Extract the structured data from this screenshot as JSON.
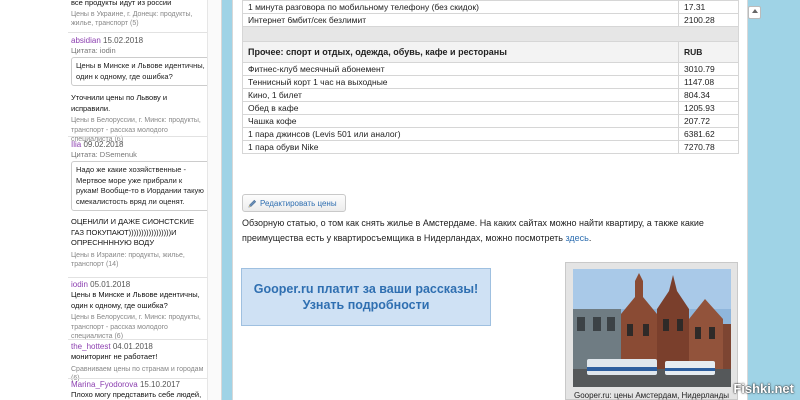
{
  "sidebar": {
    "top_text": "все продукты идут из россии",
    "top_meta": "Цены в Украине, г. Донецк: продукты, жилье, транспорт",
    "top_meta_count": "(5)",
    "comments": [
      {
        "author": "absidian",
        "date": "15.02.2018",
        "quote_label": "Цитата: iodin",
        "quote": "Цены в Минске и Львове идентичны, один к одному, где ошибка?",
        "text": "Уточнили цены по Львову и исправили.",
        "meta": "Цены в Белоруссии, г. Минск: продукты, транспорт - рассказ молодого специалиста",
        "meta_count": "(6)"
      },
      {
        "author": "Ilia",
        "date": "09.02.2018",
        "quote_label": "Цитата: DSemenuk",
        "quote": "Надо же какие хозяйственные - Мертвое море уже прибрали к рукам! Вообще-то в Иордании такую смекалистость вряд ли оценят.",
        "text": "ОЦЕНИЛИ И ДАЖЕ СИОНСТСКИЕ ГАЗ ПОКУПАЮТ)))))))))))))))))И ОПРЕСННННУЮ ВОДУ",
        "meta": "Цены в Израиле: продукты, жилье, транспорт",
        "meta_count": "(14)"
      },
      {
        "author": "iodin",
        "date": "05.01.2018",
        "text": "Цены в Минске и Львове идентичны, один к одному, где ошибка?",
        "meta": "Цены в Белоруссии, г. Минск: продукты, транспорт - рассказ молодого специалиста",
        "meta_count": "(6)"
      },
      {
        "author": "the_hottest",
        "date": "04.01.2018",
        "text": "мониторинг не работает!",
        "meta": "Сравниваем цены по странам и городам",
        "meta_count": "(6)"
      },
      {
        "author": "Marina_Fyodorova",
        "date": "15.10.2017",
        "text": "Плохо могу представить себе людей,"
      }
    ]
  },
  "table": {
    "rows_top": [
      {
        "label": "1 минута разговора по мобильному телефону (без скидок)",
        "value": "17.31"
      },
      {
        "label": "Интернет 6мбит/сек безлимит",
        "value": "2100.28"
      }
    ],
    "section_title": "Прочее: спорт и отдых, одежда, обувь, кафе и рестораны",
    "currency": "RUB",
    "rows": [
      {
        "label": "Фитнес-клуб месячный абонемент",
        "value": "3010.79"
      },
      {
        "label": "Теннисный корт 1 час на выходные",
        "value": "1147.08"
      },
      {
        "label": "Кино, 1 билет",
        "value": "804.34"
      },
      {
        "label": "Обед в кафе",
        "value": "1205.93"
      },
      {
        "label": "Чашка кофе",
        "value": "207.72"
      },
      {
        "label": "1 пара джинсов (Levis 501 или аналог)",
        "value": "6381.62"
      },
      {
        "label": "1 пара обуви Nike",
        "value": "7270.78"
      }
    ]
  },
  "edit_button": "Редактировать цены",
  "description": {
    "text": "Обзорную статью, о том как снять жилье в Амстердаме. На каких сайтах можно найти квартиру, а также какие преимущества есть у квартиросъемщика в Нидерландах, можно посмотреть ",
    "link": "здесь",
    "end": "."
  },
  "banner": {
    "line1": "Gooper.ru платит за ваши рассказы!",
    "line2": "Узнать подробности"
  },
  "photo_caption": "Gooper.ru: цены Амстердам, Нидерланды",
  "watermark": "Fishki.net",
  "colors": {
    "background": "#9fd3e6",
    "link": "#2f6fb1",
    "author": "#8c3fb0",
    "banner_bg": "#cfe1f4"
  }
}
